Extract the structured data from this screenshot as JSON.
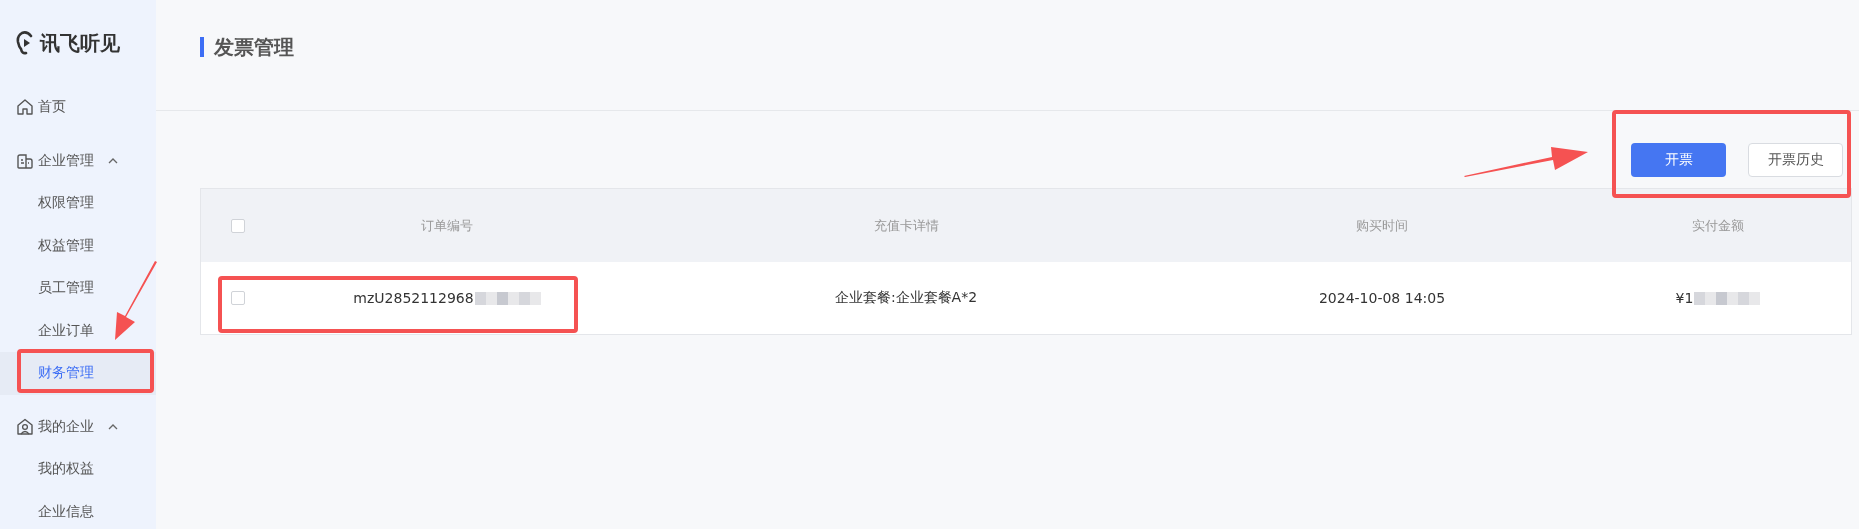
{
  "logo": {
    "text": "讯飞听见"
  },
  "sidebar": {
    "items": [
      {
        "label": "首页",
        "selected": false
      },
      {
        "label": "企业管理",
        "selected": false,
        "expanded": true,
        "children": [
          {
            "label": "权限管理",
            "selected": false
          },
          {
            "label": "权益管理",
            "selected": false
          },
          {
            "label": "员工管理",
            "selected": false
          },
          {
            "label": "企业订单",
            "selected": false
          },
          {
            "label": "财务管理",
            "selected": true
          }
        ]
      },
      {
        "label": "我的企业",
        "selected": false,
        "expanded": true,
        "children": [
          {
            "label": "我的权益",
            "selected": false
          },
          {
            "label": "企业信息",
            "selected": false
          }
        ]
      }
    ]
  },
  "page": {
    "title": "发票管理"
  },
  "toolbar": {
    "buttons": [
      {
        "label": "开票",
        "kind": "primary"
      },
      {
        "label": "开票历史",
        "kind": "default"
      }
    ]
  },
  "table": {
    "columns": [
      "订单编号",
      "充值卡详情",
      "购买时间",
      "实付金额"
    ],
    "all_checked": false,
    "rows": [
      {
        "checked": false,
        "cells": [
          {
            "text": "mzU2852112968",
            "redacted": true
          },
          {
            "text": "企业套餐:企业套餐A*2",
            "redacted": false
          },
          {
            "text": "2024-10-08 14:05",
            "redacted": false
          },
          {
            "text": "¥1",
            "redacted": true
          }
        ]
      }
    ]
  }
}
